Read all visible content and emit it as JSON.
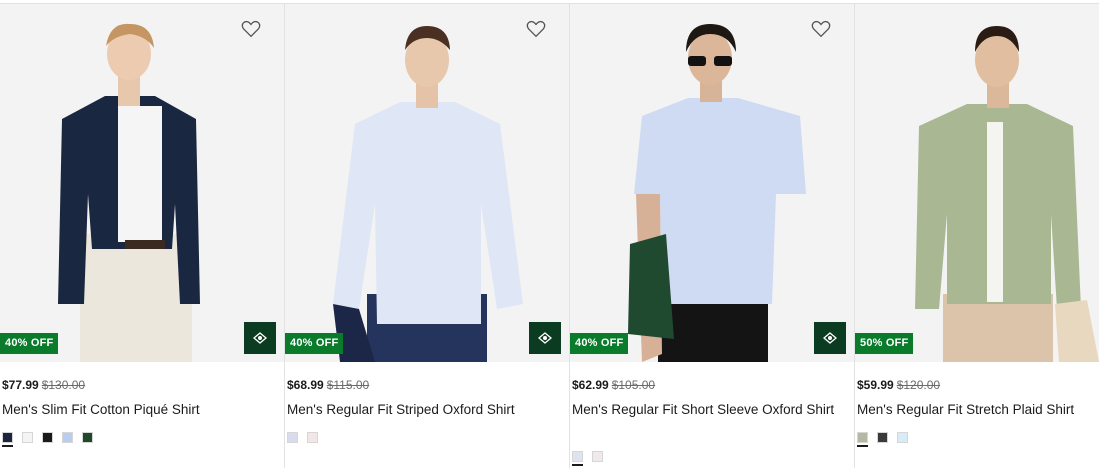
{
  "products": [
    {
      "name": "Men's Slim Fit Cotton Piqué Shirt",
      "price": "$77.99",
      "original_price": "$130.00",
      "badge": "40% OFF",
      "shirt_color": "#1a2740",
      "swatches": [
        "#1c2540",
        "#f4f4f4",
        "#1a1a1a",
        "#b9cdee",
        "#1f4a2a"
      ]
    },
    {
      "name": "Men's Regular Fit Striped Oxford Shirt",
      "price": "$68.99",
      "original_price": "$115.00",
      "badge": "40% OFF",
      "shirt_color": "#dfe6f6",
      "swatches": [
        "#d9dcec",
        "#f4e6e6"
      ]
    },
    {
      "name": "Men's Regular Fit Short Sleeve Oxford Shirt",
      "price": "$62.99",
      "original_price": "$105.00",
      "badge": "40% OFF",
      "shirt_color": "#cfdaf3",
      "swatches": [
        "#dde3ef",
        "#efe9ec"
      ]
    },
    {
      "name": "Men's Regular Fit Stretch Plaid Shirt",
      "price": "$59.99",
      "original_price": "$120.00",
      "badge": "50% OFF",
      "shirt_color": "#a9b892",
      "swatches": [
        "#b6b9a0",
        "#3a3a3a",
        "#d8ecf7"
      ]
    }
  ],
  "colors": {
    "badge": "#0a7b2b",
    "quick_view": "#0b3b21"
  },
  "icons": {
    "wishlist": "heart-icon",
    "quick_view": "eye-icon"
  }
}
